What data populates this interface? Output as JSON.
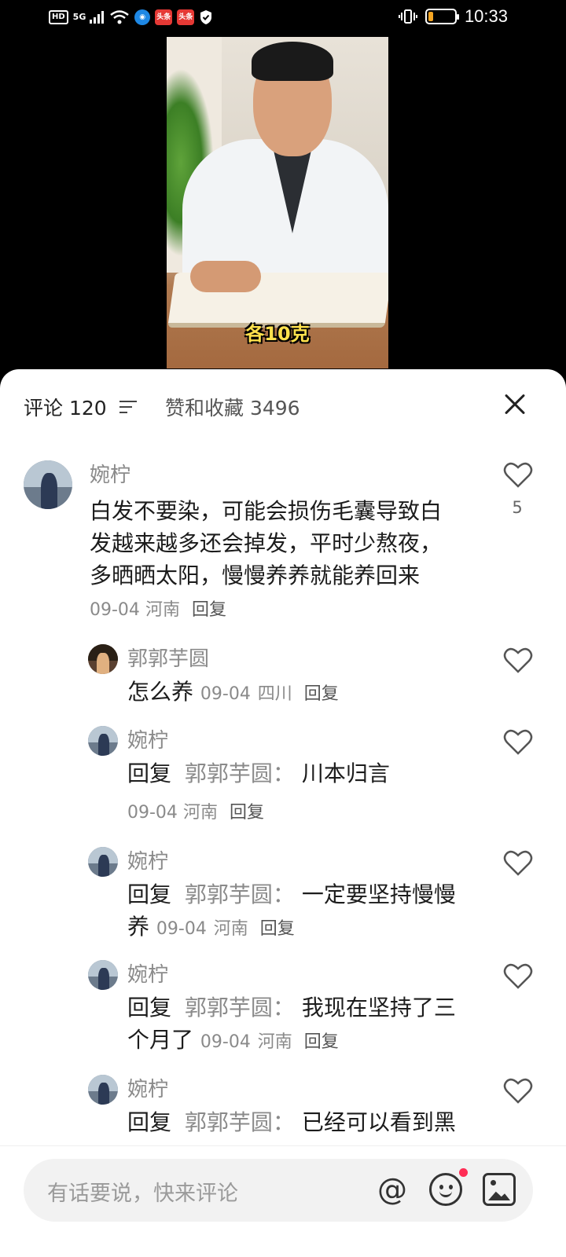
{
  "status_bar": {
    "hd": "HD",
    "network": "5G",
    "badge_a": "头条",
    "badge_b": "头条",
    "time": "10:33",
    "battery_level": 0.2
  },
  "video": {
    "subtitle": "各10克"
  },
  "sheet": {
    "comments_tab": "评论 120",
    "likes_tab": "赞和收藏 3496"
  },
  "comments": [
    {
      "name": "婉柠",
      "text_lines": [
        "白发不要染，可能会损伤毛囊导致白",
        "发越来越多还会掉发，平时少熬夜，",
        "多晒晒太阳，慢慢养养就能养回来"
      ],
      "date": "09-04",
      "location": "河南",
      "reply": "回复",
      "likes": "5"
    }
  ],
  "replies": [
    {
      "name": "郭郭芋圆",
      "text": "怎么养",
      "date": "09-04",
      "location": "四川",
      "reply": "回复"
    },
    {
      "name": "婉柠",
      "prefix": "回复",
      "reply_to": "郭郭芋圆：",
      "text": "川本归言",
      "date": "09-04",
      "location": "河南",
      "reply": "回复"
    },
    {
      "name": "婉柠",
      "prefix": "回复",
      "reply_to": "郭郭芋圆：",
      "text": "一定要坚持慢慢",
      "text2": "养",
      "date": "09-04",
      "location": "河南",
      "reply": "回复"
    },
    {
      "name": "婉柠",
      "prefix": "回复",
      "reply_to": "郭郭芋圆：",
      "text": "我现在坚持了三",
      "text2": "个月了",
      "date": "09-04",
      "location": "河南",
      "reply": "回复"
    },
    {
      "name": "婉柠",
      "prefix": "回复",
      "reply_to": "郭郭芋圆：",
      "text": "已经可以看到黑"
    }
  ],
  "input_bar": {
    "placeholder": "有话要说，快来评论",
    "at_symbol": "@"
  },
  "colors": {
    "accent_red": "#ff2d55",
    "subtitle_yellow": "#ffe14d"
  }
}
